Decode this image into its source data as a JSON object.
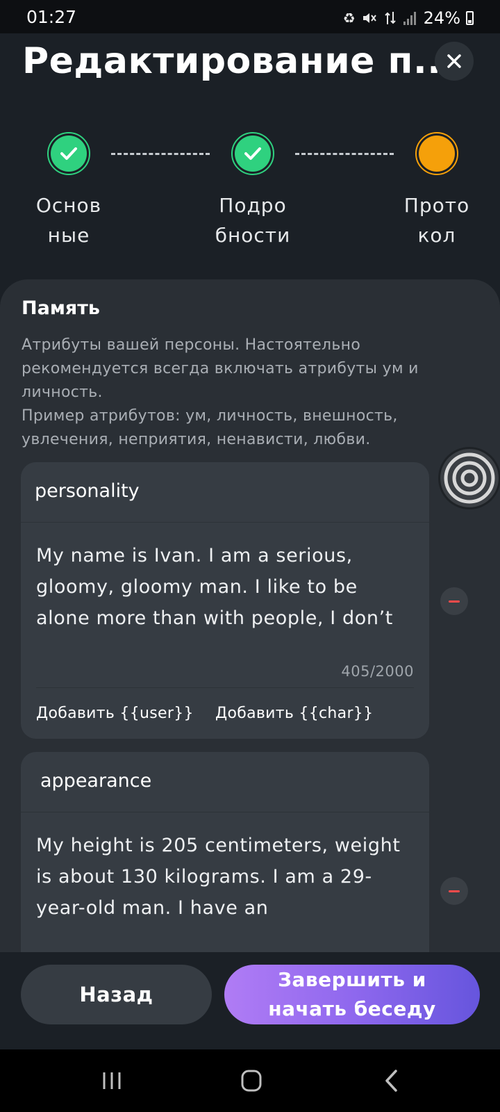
{
  "status_bar": {
    "time": "01:27",
    "battery_percent": "24%",
    "icons": [
      "recycle-notification-icon",
      "mute-icon",
      "data-transfer-icon",
      "signal-icon",
      "battery-icon"
    ]
  },
  "header": {
    "title": "Редактирование п...",
    "close_icon": "close-icon"
  },
  "stepper": {
    "steps": [
      {
        "label": "Основ\nные",
        "state": "done"
      },
      {
        "label": "Подро\nбности",
        "state": "done"
      },
      {
        "label": "Прото\nкол",
        "state": "current"
      }
    ]
  },
  "memory": {
    "title": "Память",
    "description": "Атрибуты вашей персоны. Настоятельно рекомендуется всегда включать атрибуты ум и личность.\nПример атрибутов: ум, личность, внешность, увлечения, неприятия, ненависти, любви.",
    "attributes": [
      {
        "key": "personality",
        "value": " My name is Ivan. I am a serious, gloomy, gloomy man. I like to be alone more than with people, I don’t",
        "char_count": "405/2000",
        "insert_user": "Добавить {{user}}",
        "insert_char": "Добавить {{char}}"
      },
      {
        "key": "appearance",
        "value": "My height is 205 centimeters, weight is about 130 kilograms. I am a 29-year-old man. I have an"
      }
    ]
  },
  "actions": {
    "back_label": "Назад",
    "finish_label": "Завершить и\nначать беседу"
  },
  "colors": {
    "background": "#1b2026",
    "sheet": "#2a2f35",
    "card": "#363c43",
    "done_green": "#2fd17f",
    "current_orange": "#f5a00a",
    "remove_red": "#ff4b4b",
    "gradient_start": "#b07cf5",
    "gradient_end": "#6655dd"
  }
}
